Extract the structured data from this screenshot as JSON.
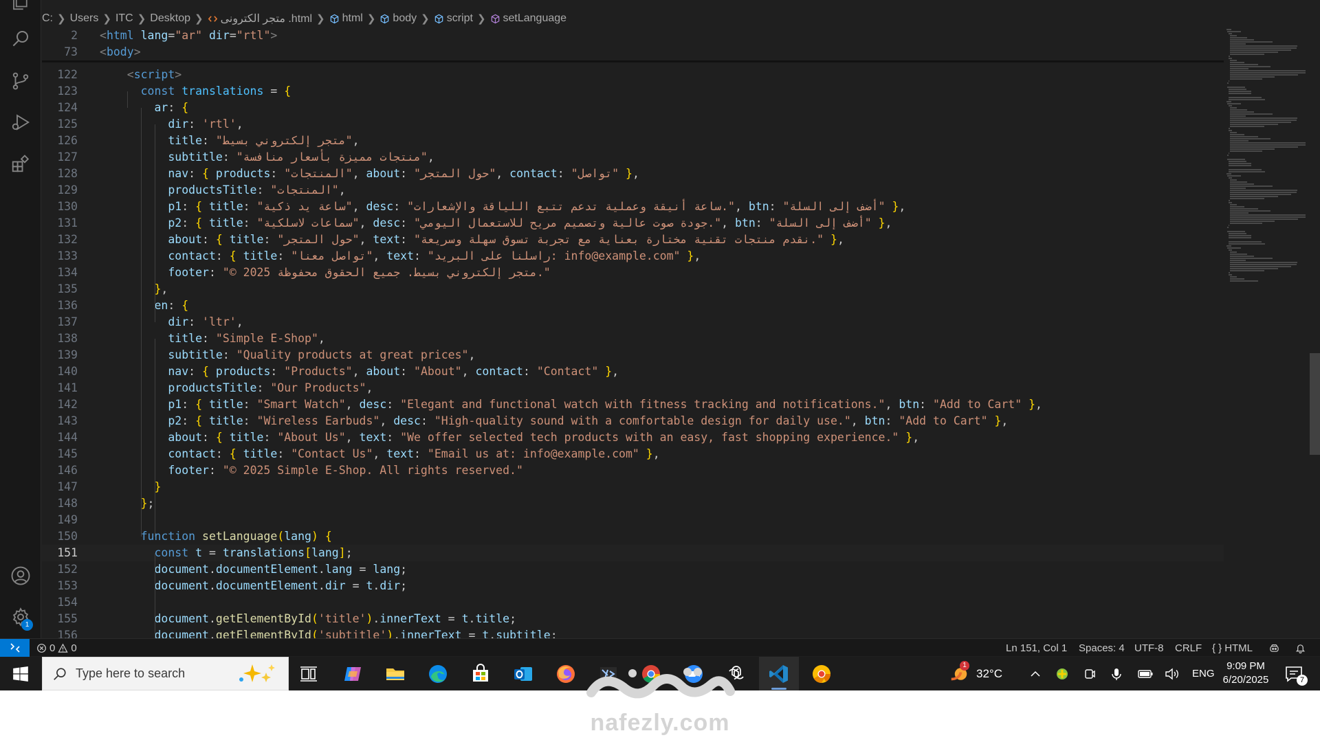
{
  "breadcrumb": {
    "path": [
      "C:",
      "Users",
      "ITC",
      "Desktop"
    ],
    "file": "متجر الكترونى .html",
    "symbols": [
      "html",
      "body",
      "script",
      "setLanguage"
    ]
  },
  "sticky": [
    {
      "n": "2",
      "code": "<html lang=\"ar\" dir=\"rtl\">"
    },
    {
      "n": "73",
      "code": "<body>"
    }
  ],
  "lines": [
    {
      "n": "122",
      "code": "    <script>"
    },
    {
      "n": "123",
      "code": "      const translations = {"
    },
    {
      "n": "124",
      "code": "        ar: {"
    },
    {
      "n": "125",
      "code": "          dir: 'rtl',"
    },
    {
      "n": "126",
      "code": "          title: \"متجر إلكتروني بسيط\","
    },
    {
      "n": "127",
      "code": "          subtitle: \"منتجات مميزة بأسعار منافسة\","
    },
    {
      "n": "128",
      "code": "          nav: { products: \"المنتجات\", about: \"حول المتجر\", contact: \"تواصل\" },"
    },
    {
      "n": "129",
      "code": "          productsTitle: \"المنتجات\","
    },
    {
      "n": "130",
      "code": "          p1: { title: \"ساعة يد ذكية\", desc: \"ساعة أنيقة وعملية تدعم تتبع اللياقة والإشعارات.\", btn: \"أضف إلى السلة\" },"
    },
    {
      "n": "131",
      "code": "          p2: { title: \"سماعات لاسلكية\", desc: \"جودة صوت عالية وتصميم مريح للاستعمال اليومي.\", btn: \"أضف إلى السلة\" },"
    },
    {
      "n": "132",
      "code": "          about: { title: \"حول المتجر\", text: \"نقدم منتجات تقنية مختارة بعناية مع تجربة تسوق سهلة وسريعة.\" },"
    },
    {
      "n": "133",
      "code": "          contact: { title: \"تواصل معنا\", text: \"راسلنا على البريد: info@example.com\" },"
    },
    {
      "n": "134",
      "code": "          footer: \"© 2025 متجر إلكتروني بسيط. جميع الحقوق محفوظة.\""
    },
    {
      "n": "135",
      "code": "        },"
    },
    {
      "n": "136",
      "code": "        en: {"
    },
    {
      "n": "137",
      "code": "          dir: 'ltr',"
    },
    {
      "n": "138",
      "code": "          title: \"Simple E-Shop\","
    },
    {
      "n": "139",
      "code": "          subtitle: \"Quality products at great prices\","
    },
    {
      "n": "140",
      "code": "          nav: { products: \"Products\", about: \"About\", contact: \"Contact\" },"
    },
    {
      "n": "141",
      "code": "          productsTitle: \"Our Products\","
    },
    {
      "n": "142",
      "code": "          p1: { title: \"Smart Watch\", desc: \"Elegant and functional watch with fitness tracking and notifications.\", btn: \"Add to Cart\" },"
    },
    {
      "n": "143",
      "code": "          p2: { title: \"Wireless Earbuds\", desc: \"High-quality sound with a comfortable design for daily use.\", btn: \"Add to Cart\" },"
    },
    {
      "n": "144",
      "code": "          about: { title: \"About Us\", text: \"We offer selected tech products with an easy, fast shopping experience.\" },"
    },
    {
      "n": "145",
      "code": "          contact: { title: \"Contact Us\", text: \"Email us at: info@example.com\" },"
    },
    {
      "n": "146",
      "code": "          footer: \"© 2025 Simple E-Shop. All rights reserved.\""
    },
    {
      "n": "147",
      "code": "        }"
    },
    {
      "n": "148",
      "code": "      };"
    },
    {
      "n": "149",
      "code": ""
    },
    {
      "n": "150",
      "code": "      function setLanguage(lang) {"
    },
    {
      "n": "151",
      "code": "        const t = translations[lang];"
    },
    {
      "n": "152",
      "code": "        document.documentElement.lang = lang;"
    },
    {
      "n": "153",
      "code": "        document.documentElement.dir = t.dir;"
    },
    {
      "n": "154",
      "code": ""
    },
    {
      "n": "155",
      "code": "        document.getElementById('title').innerText = t.title;"
    },
    {
      "n": "156",
      "code": "        document.getElementById('subtitle').innerText = t.subtitle;"
    }
  ],
  "active_line": "151",
  "activity_bar": [
    "explorer-icon",
    "search-icon",
    "source-control-icon",
    "run-debug-icon",
    "extensions-icon",
    "account-icon",
    "settings-icon"
  ],
  "settings_badge": "1",
  "status": {
    "errors": "0",
    "warnings": "0",
    "position": "Ln 151, Col 1",
    "spaces": "Spaces: 4",
    "encoding": "UTF-8",
    "eol": "CRLF",
    "language": "HTML"
  },
  "taskbar": {
    "search_placeholder": "Type here to search",
    "apps": [
      "task-view",
      "copilot",
      "file-explorer",
      "edge",
      "microsoft-store",
      "outlook",
      "firefox",
      "git-gui",
      "chrome",
      "zoom",
      "chatgpt",
      "vscode",
      "chrome-canary"
    ],
    "active_app": "vscode",
    "weather_temp": "32°C",
    "weather_badge": "1",
    "language": "ENG",
    "time": "9:09 PM",
    "date": "6/20/2025",
    "notifications": "7"
  },
  "watermark": {
    "logo_text": "نفذلي",
    "url": "nafezly.com"
  },
  "colors": {
    "editor_bg": "#1f1f1f",
    "accent": "#0078d4",
    "keyword": "#569cd6",
    "string": "#ce9178",
    "variable": "#9cdcfe",
    "function": "#dcdcaa"
  }
}
